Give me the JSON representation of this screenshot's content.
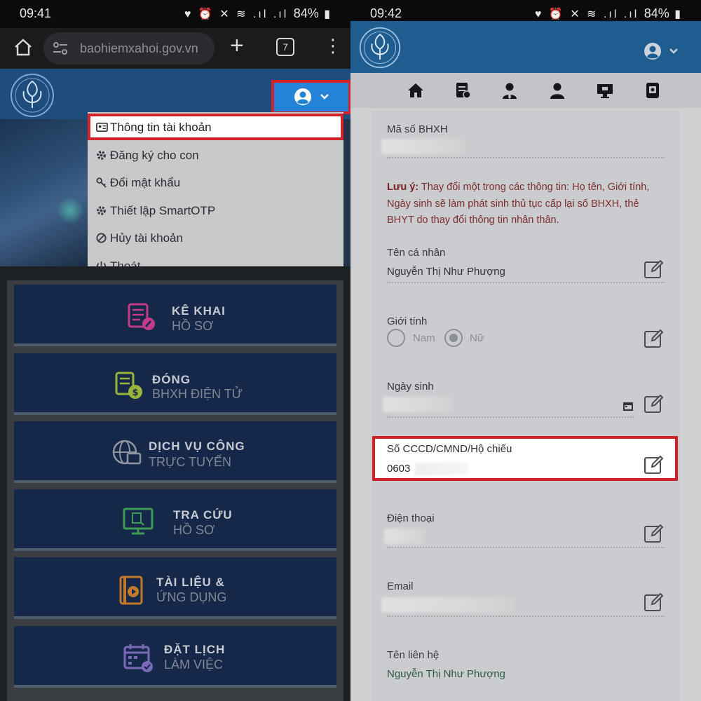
{
  "left": {
    "status": {
      "time": "09:41",
      "battery": "84%"
    },
    "browser": {
      "url": "baohiemxahoi.gov.vn",
      "tab_count": "7"
    },
    "dropdown": {
      "items": [
        {
          "label": "Thông tin tài khoản",
          "icon": "id-card-icon",
          "active": true
        },
        {
          "label": "Đăng ký cho con",
          "icon": "gear-icon"
        },
        {
          "label": "Đổi mật khẩu",
          "icon": "key-icon"
        },
        {
          "label": "Thiết lập SmartOTP",
          "icon": "gear-icon"
        },
        {
          "label": "Hủy tài khoản",
          "icon": "ban-icon"
        },
        {
          "label": "Thoát",
          "icon": "power-icon"
        }
      ]
    },
    "tiles": [
      {
        "line1": "KÊ KHAI",
        "line2": "HỒ SƠ",
        "icon": "declare-form-icon",
        "color": "#c23a8c"
      },
      {
        "line1": "ĐÓNG",
        "line2": "BHXH ĐIỆN TỬ",
        "icon": "payment-icon",
        "color": "#9ab53a"
      },
      {
        "line1": "DỊCH VỤ CÔNG",
        "line2": "TRỰC TUYẾN",
        "icon": "globe-icon",
        "color": "#8f959e"
      },
      {
        "line1": "TRA CỨU",
        "line2": "HỒ SƠ",
        "icon": "monitor-search-icon",
        "color": "#3c9a52"
      },
      {
        "line1": "TÀI LIỆU &",
        "line2": "ỨNG DỤNG",
        "icon": "document-play-icon",
        "color": "#c27a2a"
      },
      {
        "line1": "ĐẶT LỊCH",
        "line2": "LÀM VIỆC",
        "icon": "calendar-icon",
        "color": "#7b6ab5"
      }
    ]
  },
  "right": {
    "status": {
      "time": "09:42",
      "battery": "84%"
    },
    "nav_icons": [
      "home-icon",
      "document-list-icon",
      "user-tie-icon",
      "user-icon",
      "desktop-icon",
      "device-icon"
    ],
    "fields": {
      "bhxh_label": "Mã số BHXH",
      "note_prefix": "Lưu ý:",
      "note_text": " Thay đổi một trong các thông tin: Họ tên, Giới tính, Ngày sinh sẽ làm phát sinh thủ tục cấp lại số BHXH, thẻ BHYT do thay đổi thông tin nhân thân.",
      "name_label": "Tên cá nhân",
      "name_value": "Nguyễn Thị Như Phượng",
      "gender_label": "Giới tính",
      "gender_male": "Nam",
      "gender_female": "Nữ",
      "gender_selected": "Nữ",
      "dob_label": "Ngày sinh",
      "id_label": "Số CCCD/CMND/Hộ chiếu",
      "id_value": "0603",
      "phone_label": "Điện thoại",
      "email_label": "Email",
      "contact_label": "Tên liên hệ",
      "contact_value": "Nguyễn Thị Như Phượng"
    }
  },
  "colors": {
    "highlight_border": "#d2232a",
    "header_blue": "#1f5c8f",
    "user_button": "#2383d6"
  }
}
